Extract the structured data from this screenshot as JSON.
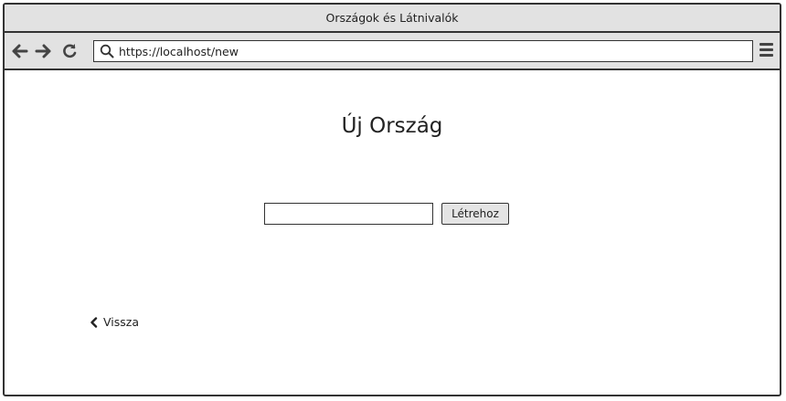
{
  "window": {
    "title": "Országok és Látnivalók"
  },
  "toolbar": {
    "back_icon": "arrow-left-icon",
    "forward_icon": "arrow-right-icon",
    "reload_icon": "reload-icon",
    "search_icon": "search-icon",
    "url": "https://localhost/new",
    "menu_icon": "hamburger-menu-icon"
  },
  "main": {
    "title": "Új Ország",
    "name_input_value": "",
    "create_button_label": "Létrehoz",
    "back_link_label": "Vissza",
    "back_link_icon": "chevron-left-icon"
  },
  "colors": {
    "chrome_bg": "#e2e2e2",
    "border": "#333333",
    "button_bg": "#e4e4e4"
  }
}
